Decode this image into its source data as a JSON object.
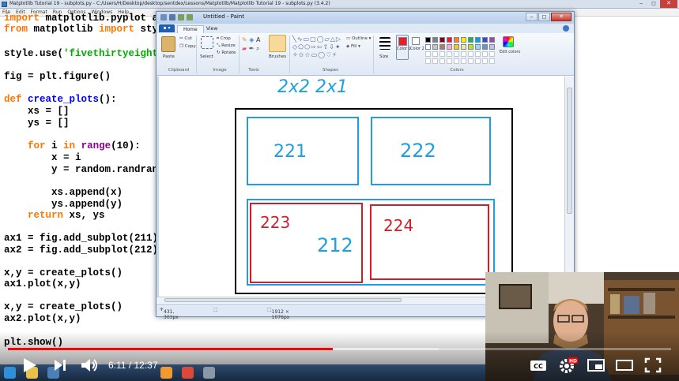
{
  "ide": {
    "title": "Matplotlib Tutorial 19 - subplots.py - C:/Users/H/Desktop/desktop/sentdex/Lessons/Matplotlib/Matplotlib Tutorial 19 - subplots.py (3.4.2)",
    "menu": [
      "File",
      "Edit",
      "Format",
      "Run",
      "Options",
      "Windows",
      "Help"
    ],
    "code": [
      {
        "parts": [
          [
            "kw",
            "import"
          ],
          [
            "",
            " matplotlib.pyplot as plt"
          ]
        ]
      },
      {
        "parts": [
          [
            "kw",
            "from"
          ],
          [
            "",
            " matplotlib "
          ],
          [
            "kw",
            "import"
          ],
          [
            "",
            " style"
          ]
        ]
      },
      {
        "parts": [
          [
            "",
            "style.use("
          ],
          [
            "str",
            "'fivethirtyeight'"
          ],
          [
            "",
            ")"
          ]
        ]
      },
      {
        "parts": [
          [
            "",
            "fig = plt.figure()"
          ]
        ]
      },
      {
        "parts": [
          [
            "kw",
            "def"
          ],
          [
            "",
            " "
          ],
          [
            "fn",
            "create_plots"
          ],
          [
            "",
            "():"
          ]
        ]
      },
      {
        "parts": [
          [
            "",
            "    xs = []"
          ]
        ]
      },
      {
        "parts": [
          [
            "",
            "    ys = []"
          ]
        ]
      },
      {
        "parts": [
          [
            "",
            "    "
          ],
          [
            "kw",
            "for"
          ],
          [
            "",
            " i "
          ],
          [
            "kw",
            "in"
          ],
          [
            "",
            " "
          ],
          [
            "bi",
            "range"
          ],
          [
            "",
            "(10):"
          ]
        ]
      },
      {
        "parts": [
          [
            "",
            "        x = i"
          ]
        ]
      },
      {
        "parts": [
          [
            "",
            "        y = random.randrange(10)"
          ]
        ]
      },
      {
        "parts": [
          [
            "",
            "        xs.append(x)"
          ]
        ]
      },
      {
        "parts": [
          [
            "",
            "        ys.append(y)"
          ]
        ]
      },
      {
        "parts": [
          [
            "",
            "    "
          ],
          [
            "kw",
            "return"
          ],
          [
            "",
            " xs, ys"
          ]
        ]
      },
      {
        "parts": [
          [
            "",
            "ax1 = fig.add_subplot(211)"
          ]
        ]
      },
      {
        "parts": [
          [
            "",
            "ax2 = fig.add_subplot(212)"
          ]
        ]
      },
      {
        "parts": [
          [
            "",
            "x,y = create_plots()"
          ]
        ]
      },
      {
        "parts": [
          [
            "",
            "ax1.plot(x,y)"
          ]
        ]
      },
      {
        "parts": [
          [
            "",
            "x,y = create_plots()"
          ]
        ]
      },
      {
        "parts": [
          [
            "",
            "ax2.plot(x,y)"
          ]
        ]
      },
      {
        "parts": [
          [
            "",
            "plt.show()"
          ]
        ]
      }
    ]
  },
  "paint": {
    "title": "Untitled - Paint",
    "file_tab": "▪ ▾",
    "tabs": [
      "Home",
      "View"
    ],
    "ribbon": {
      "paste": "Paste",
      "cut": "Cut",
      "copy": "Copy",
      "select": "Select",
      "crop": "Crop",
      "resize": "Resize",
      "rotate": "Rotate",
      "brushes": "Brushes",
      "outline": "Outline",
      "fill": "Fill",
      "size": "Size",
      "color1": "Color 1",
      "color2": "Color 2",
      "edit_colors": "Edit colors",
      "groups": [
        "Clipboard",
        "Image",
        "Tools",
        "Shapes",
        "Colors"
      ]
    },
    "palette": [
      "#000000",
      "#7f7f7f",
      "#880015",
      "#ed1c24",
      "#ff7f27",
      "#fff200",
      "#22b14c",
      "#00a2e8",
      "#3f48cc",
      "#a349a4",
      "#ffffff",
      "#c3c3c3",
      "#b97a57",
      "#ffaec9",
      "#ffc90e",
      "#efe4b0",
      "#b5e61d",
      "#99d9ea",
      "#7092be",
      "#c8bfe7"
    ],
    "color1": "#ed1c24",
    "color2": "#ffffff",
    "status": {
      "cursor": "431, 303px",
      "size": "1912 × 1076px"
    },
    "drawing": {
      "header": "2x2  2x1",
      "labels": [
        "221",
        "222",
        "223",
        "224",
        "212"
      ],
      "colors": {
        "blue": "#1ea0e0",
        "red": "#d21e2a",
        "black": "#000000"
      }
    }
  },
  "player": {
    "time_current": "6:11",
    "time_total": "12:37",
    "time_display": "6:11 / 12:37",
    "progress": 0.49,
    "loaded": 0.65
  }
}
